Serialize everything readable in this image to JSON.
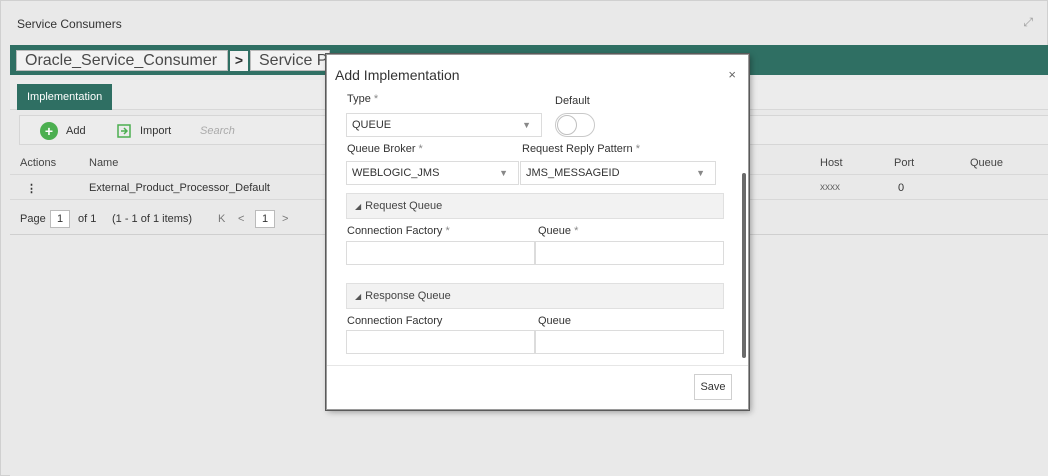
{
  "window": {
    "title": "Service Consumers"
  },
  "breadcrumb": {
    "items": [
      "Oracle_Service_Consumer",
      "Service Pro"
    ],
    "separator": ">"
  },
  "tabs": [
    {
      "label": "Implementation",
      "active": true
    }
  ],
  "toolbar": {
    "add_label": "Add",
    "import_label": "Import",
    "search_placeholder": "Search"
  },
  "table": {
    "columns": [
      "Actions",
      "Name",
      "Host",
      "Port",
      "Queue"
    ],
    "rows": [
      {
        "actions": "⋮",
        "name": "External_Product_Processor_Default",
        "host": "xxxx",
        "port": "0",
        "queue": ""
      }
    ]
  },
  "pager": {
    "page_label": "Page",
    "page_value": "1",
    "of_text": "of 1",
    "items_text": "(1 - 1 of 1 items)",
    "first": "K",
    "prev": "<",
    "current": "1",
    "next": ">"
  },
  "dialog": {
    "title": "Add Implementation",
    "close": "×",
    "type_label": "Type",
    "type_value": "QUEUE",
    "default_label": "Default",
    "default_on": false,
    "queue_broker_label": "Queue Broker",
    "queue_broker_value": "WEBLOGIC_JMS",
    "pattern_label": "Request Reply Pattern",
    "pattern_value": "JMS_MESSAGEID",
    "request_section": "Request Queue",
    "request_cf_label": "Connection Factory",
    "request_queue_label": "Queue",
    "request_cf_value": "",
    "request_queue_value": "",
    "response_section": "Response Queue",
    "response_cf_label": "Connection Factory",
    "response_queue_label": "Queue",
    "response_cf_value": "",
    "response_queue_value": "",
    "required_mark": "*",
    "save_label": "Save"
  },
  "colors": {
    "brand": "#2f6f63",
    "add_icon": "#4caf50"
  }
}
